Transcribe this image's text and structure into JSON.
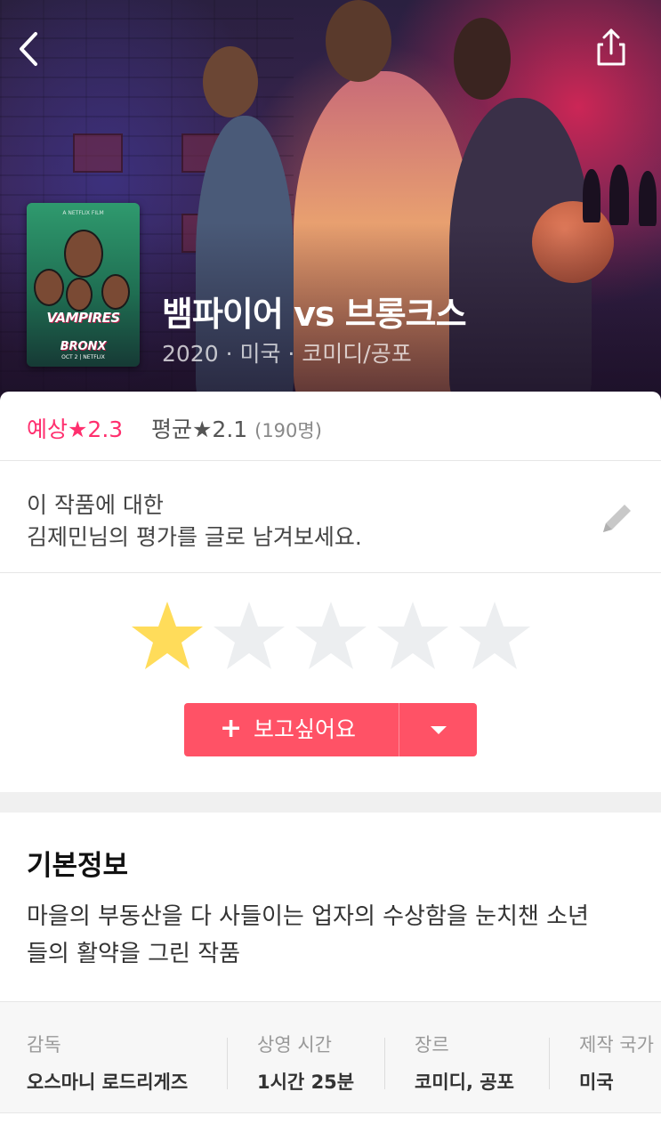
{
  "movie": {
    "title": "뱀파이어 vs 브롱크스",
    "meta": "2020 · 미국 · 코미디/공포",
    "poster": {
      "top_text": "A NETFLIX FILM",
      "title_line1": "VAMPIRES",
      "title_line2": "BRONX",
      "date": "OCT 2 | NETFLIX"
    }
  },
  "ratings": {
    "predicted": "예상★2.3",
    "average": "평균★2.1",
    "count": "(190명)"
  },
  "comment_prompt": {
    "line1": "이 작품에 대한",
    "line2": "김제민님의 평가를 글로 남겨보세요."
  },
  "user_rating": {
    "value": 1,
    "max": 5
  },
  "want_button": {
    "plus": "+",
    "label": "보고싶어요"
  },
  "info": {
    "title": "기본정보",
    "description_line1": "마을의 부동산을 다 사들이는 업자의 수상함을 눈치챈 소년",
    "description_line2": "들의 활약을 그린 작품",
    "fields": [
      {
        "label": "감독",
        "value": "오스마니 로드리게즈"
      },
      {
        "label": "상영 시간",
        "value": "1시간 25분"
      },
      {
        "label": "장르",
        "value": "코미디, 공포"
      },
      {
        "label": "제작 국가",
        "value": "미국"
      }
    ]
  },
  "colors": {
    "accent": "#ff2f6e",
    "button": "#ff5266",
    "star_filled": "#ffdc5a",
    "star_empty": "#eceef0"
  },
  "icons": [
    "back-arrow-icon",
    "share-icon",
    "pencil-icon",
    "star-icon",
    "plus-icon",
    "dropdown-arrow-icon"
  ]
}
